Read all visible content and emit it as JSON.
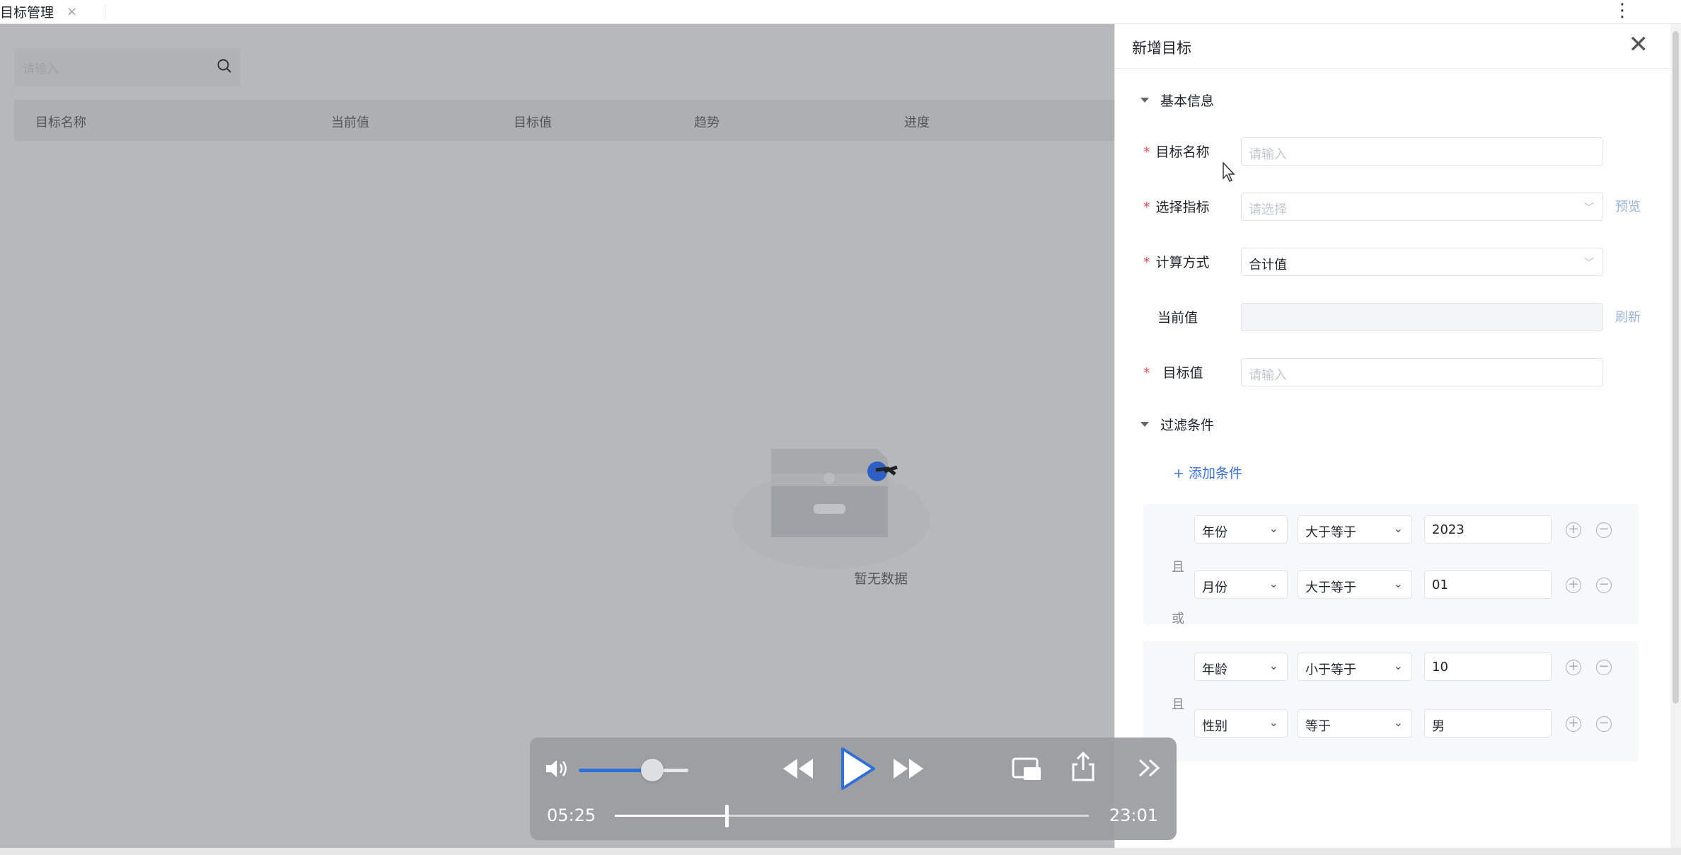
{
  "tab": {
    "title": "目标管理",
    "close": "×"
  },
  "more_icon": "⋮",
  "list": {
    "search_placeholder": "请输入",
    "columns": [
      "目标名称",
      "当前值",
      "目标值",
      "趋势",
      "进度"
    ],
    "empty_text": "暂无数据"
  },
  "drawer": {
    "title": "新增目标",
    "close": "✕",
    "section_basic": "基本信息",
    "fields": {
      "name": {
        "label": "目标名称",
        "placeholder": "请输入"
      },
      "metric": {
        "label": "选择指标",
        "placeholder": "请选择",
        "link": "预览"
      },
      "calc": {
        "label": "计算方式",
        "value": "合计值"
      },
      "current": {
        "label": "当前值",
        "value": "",
        "link": "刷新"
      },
      "target": {
        "label": "目标值",
        "placeholder": "请输入"
      }
    },
    "section_filter": "过滤条件",
    "add_condition": "+ 添加条件",
    "or_label": "或",
    "groups": [
      {
        "connector": "且",
        "rows": [
          {
            "field": "年份",
            "operator": "大于等于",
            "value": "2023"
          },
          {
            "field": "月份",
            "operator": "大于等于",
            "value": "01"
          }
        ]
      },
      {
        "connector": "且",
        "rows": [
          {
            "field": "年龄",
            "operator": "小于等于",
            "value": "10"
          },
          {
            "field": "性别",
            "operator": "等于",
            "value": "男"
          }
        ]
      }
    ]
  },
  "player": {
    "current_time": "05:25",
    "total_time": "23:01",
    "volume": 0.67,
    "progress": 0.236
  }
}
